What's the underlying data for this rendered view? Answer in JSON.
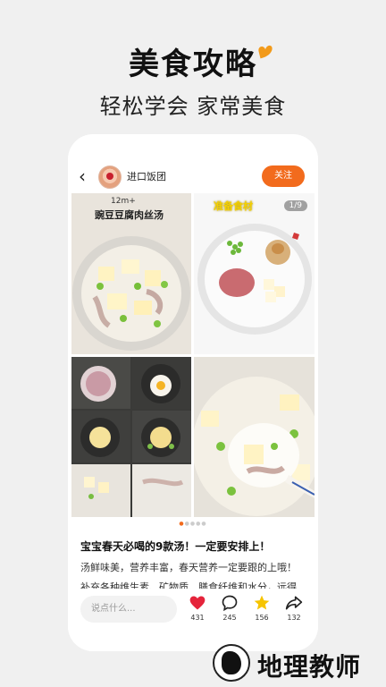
{
  "promo": {
    "title": "美食攻略",
    "subtitle": "轻松学会 家常美食"
  },
  "post": {
    "username": "进口饭团",
    "follow_label": "关注",
    "image_age": "12m+",
    "image_dish": "豌豆豆腐肉丝汤",
    "image_tag": "准备食材",
    "pager": "1/9",
    "title": "宝宝春天必喝的9款汤！一定要安排上！",
    "body": "汤鲜味美，营养丰富，春天营养一定要跟的上哦！补充各种维生素、矿物质、膳食纤维和水分，远得汤汤美美，营养摄取更均衡哦"
  },
  "actions": {
    "comment_placeholder": "说点什么...",
    "likes": "431",
    "comments": "245",
    "favorites": "156",
    "shares": "132"
  },
  "watermark": {
    "text": "地理教师"
  },
  "colors": {
    "accent": "#f26b1d",
    "like": "#e5243b",
    "star": "#f6c400"
  }
}
